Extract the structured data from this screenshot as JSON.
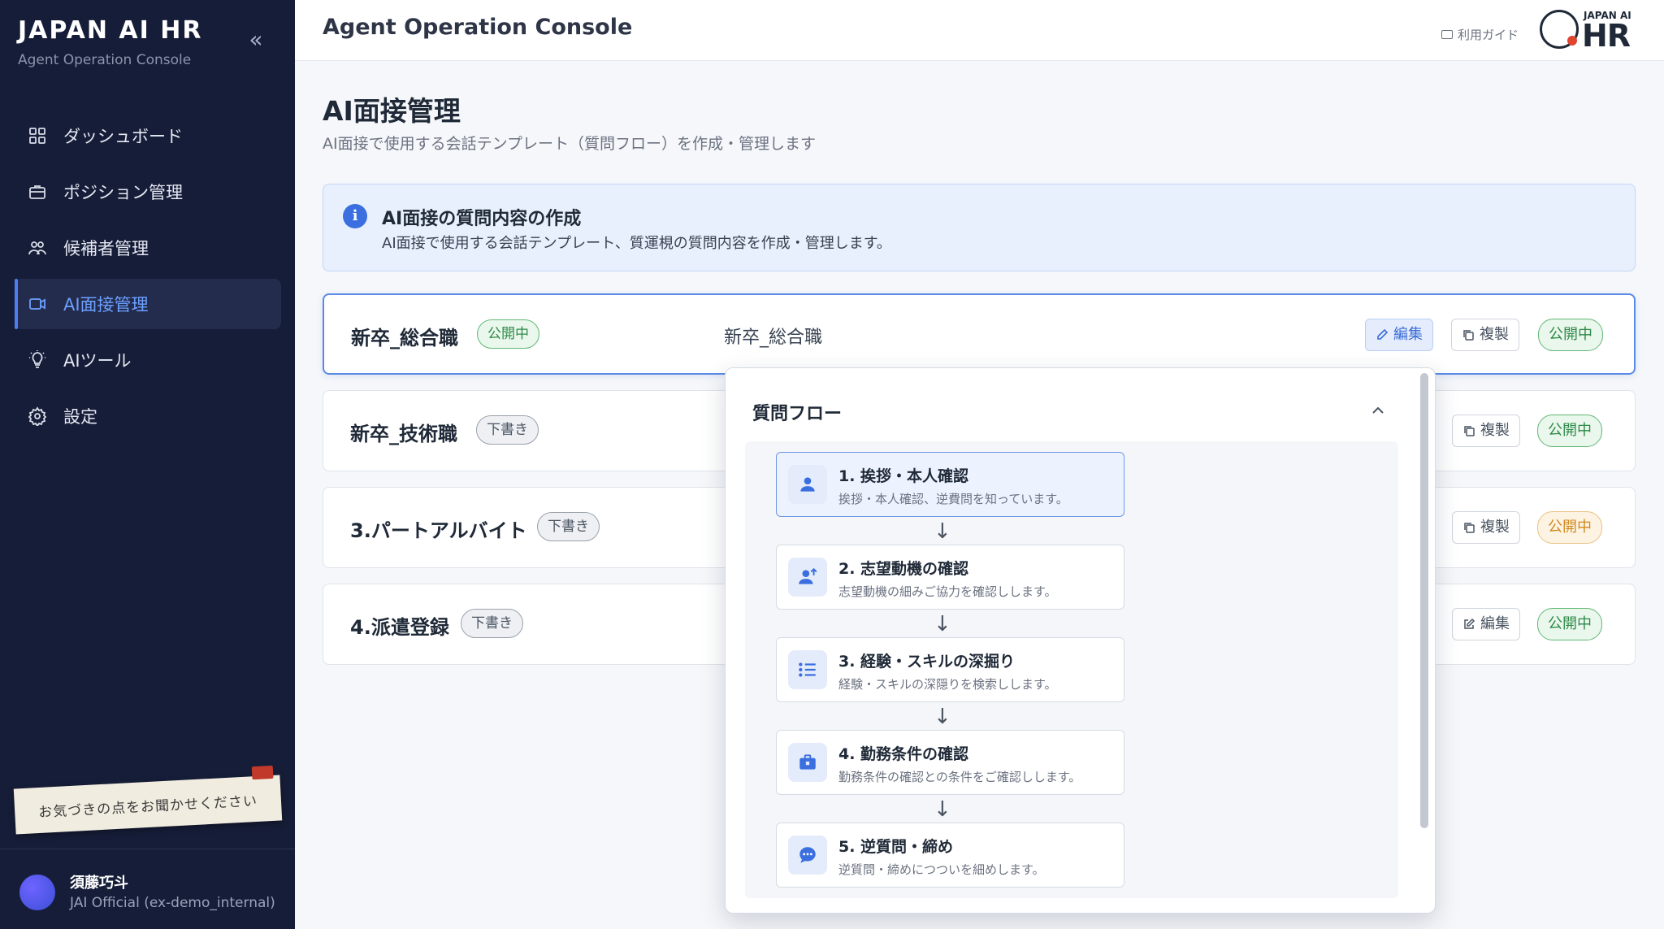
{
  "sidebar": {
    "brand_title": "JAPAN AI HR",
    "brand_subtitle": "Agent Operation Console",
    "collapse_icon": "double-chevron-left-icon",
    "items": [
      {
        "label": "ダッシュボード",
        "icon": "grid-icon",
        "active": false
      },
      {
        "label": "ポジション管理",
        "icon": "briefcase-icon",
        "active": false
      },
      {
        "label": "候補者管理",
        "icon": "users-icon",
        "active": false
      },
      {
        "label": "AI面接管理",
        "icon": "video-icon",
        "active": true
      },
      {
        "label": "AIツール",
        "icon": "lightbulb-icon",
        "active": false
      },
      {
        "label": "設定",
        "icon": "gear-icon",
        "active": false
      }
    ],
    "feedback_note": "お気づきの点をお聞かせください",
    "user": {
      "name": "須藤巧斗",
      "org": "JAI Official (ex-demo_internal)"
    }
  },
  "header": {
    "title": "Agent Operation Console",
    "guide_label": "利用ガイド",
    "logo_small": "JAPAN AI",
    "logo_large": "HR"
  },
  "main": {
    "page_title": "AI面接管理",
    "page_description": "AI面接で使用する会話テンプレート（質問フロー）を作成・管理します",
    "info": {
      "title": "AI面接の質問内容の作成",
      "text": "AI面接で使用する会話テンプレート、質運梘の質問内容を作成・管理します。"
    },
    "templates": [
      {
        "name": "新卒_総合職",
        "status": "公開中",
        "description": "新卒_総合職",
        "edit": "編集",
        "copy": "複製",
        "publish": "公開中"
      },
      {
        "name": "新卒_技術職",
        "status": "下書き",
        "copy": "複製",
        "publish": "公開中"
      },
      {
        "name": "3.パートアルバイト",
        "status": "下書き",
        "copy": "複製",
        "publish": "公開中"
      },
      {
        "name": "4.派遣登録",
        "status": "下書き",
        "edit": "編集",
        "publish": "公開中"
      }
    ]
  },
  "flow": {
    "title": "質問フロー",
    "steps": [
      {
        "title": "1. 挨拶・本人確認",
        "subtitle": "挨拶・本人確認、逆費問を知っています。",
        "icon": "user-icon"
      },
      {
        "title": "2. 志望動機の確認",
        "subtitle": "志望動機の細みご協力を確認しします。",
        "icon": "user-arrow-icon"
      },
      {
        "title": "3. 経験・スキルの深掘り",
        "subtitle": "経験・スキルの深隠りを検索しします。",
        "icon": "list-icon"
      },
      {
        "title": "4. 勤務条件の確認",
        "subtitle": "勤務条件の確認との条件をご確認しします。",
        "icon": "briefcase-icon"
      },
      {
        "title": "5. 逆質問・締め",
        "subtitle": "逆質問・締めにつついを細めします。",
        "icon": "chat-bubble-icon"
      }
    ]
  },
  "colors": {
    "sidebar_bg": "#161d38",
    "accent": "#3b6fe0",
    "published": "#2f8a48",
    "draft": "#4b5563",
    "published_orange": "#d08a1e"
  }
}
